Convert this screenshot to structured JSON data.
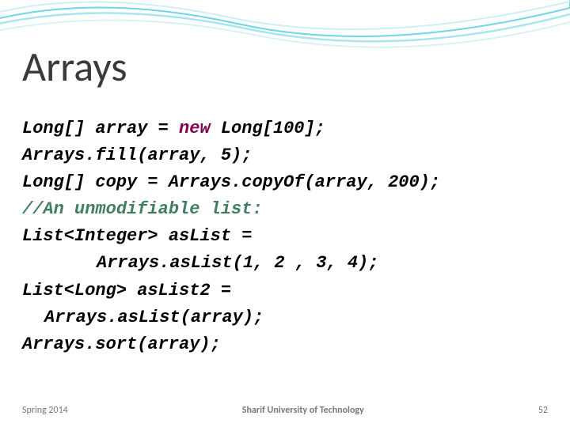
{
  "title": "Arrays",
  "code": {
    "l1_a": "Long[] array = ",
    "l1_new": "new",
    "l1_b": " Long[100];",
    "l2": "Arrays.fill(array, 5);",
    "l3": "Long[] copy = Arrays.copyOf(array, 200);",
    "l4": "//An unmodifiable list:",
    "l5": "List<Integer> asList = ",
    "l6": "Arrays.asList(1, 2 , 3, 4);",
    "l7": "List<Long> asList2 = ",
    "l8": "Arrays.asList(array);",
    "l9": "Arrays.sort(array);"
  },
  "footer": {
    "left": "Spring 2014",
    "center": "Sharif University of Technology",
    "right": "52"
  }
}
